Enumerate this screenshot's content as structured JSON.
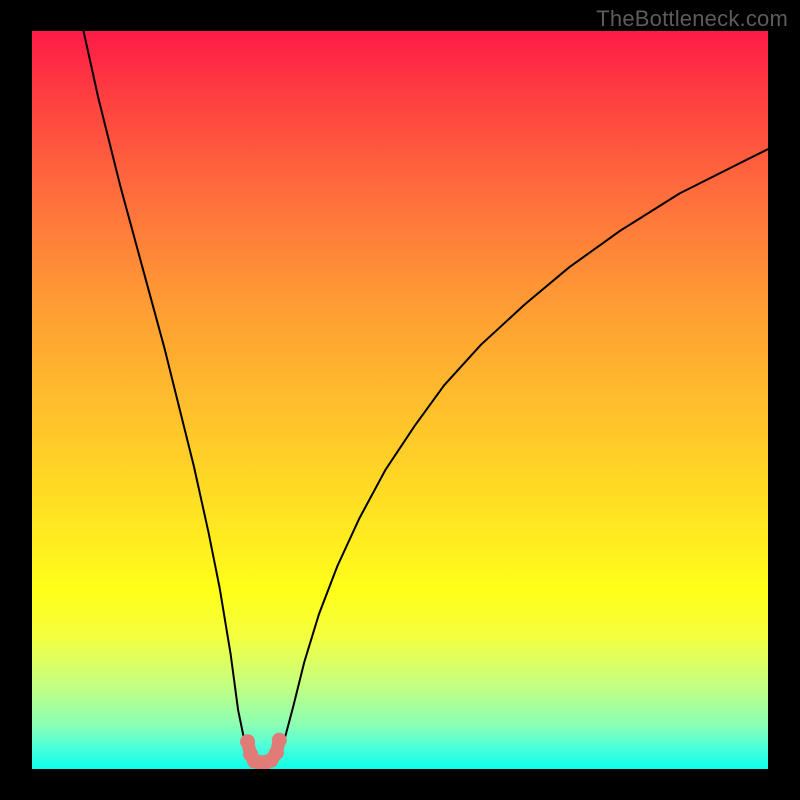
{
  "watermark": "TheBottleneck.com",
  "chart_data": {
    "type": "line",
    "title": "",
    "xlabel": "",
    "ylabel": "",
    "xlim": [
      0,
      100
    ],
    "ylim": [
      0,
      100
    ],
    "series": [
      {
        "name": "curve",
        "x": [
          7,
          9,
          12,
          15,
          18,
          20,
          22,
          24,
          25.5,
          27,
          28,
          29,
          29.8,
          30.6,
          32.4,
          33.2,
          34.2,
          35.5,
          37,
          39,
          41.5,
          44.5,
          48,
          52,
          56,
          61,
          67,
          73,
          80,
          88,
          97,
          100
        ],
        "y": [
          100,
          91,
          79,
          68,
          57,
          49,
          41,
          32,
          24.5,
          15.5,
          8,
          3.2,
          1.2,
          0.8,
          0.8,
          1.3,
          3.6,
          8.5,
          14.5,
          21,
          27.5,
          34,
          40.5,
          46.5,
          52,
          57.5,
          63,
          68,
          73,
          78,
          82.5,
          84
        ]
      },
      {
        "name": "marker-dots",
        "x": [
          29.3,
          29.7,
          30.2,
          30.9,
          31.7,
          32.5,
          33.2,
          33.6
        ],
        "y": [
          3.7,
          2.0,
          1.1,
          0.9,
          0.9,
          1.2,
          2.2,
          3.9
        ]
      }
    ],
    "colors": {
      "curve": "#000000",
      "markers": "#e07b78",
      "background_gradient": [
        "#fd1b47",
        "#ff9635",
        "#ffff19",
        "#0dffe8"
      ]
    }
  }
}
